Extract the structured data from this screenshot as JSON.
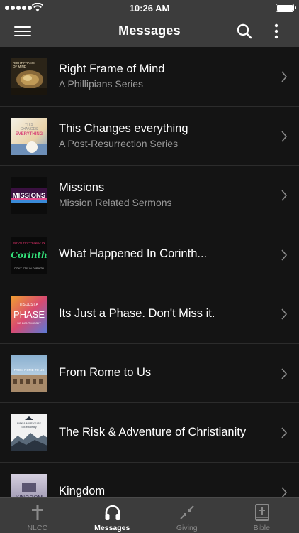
{
  "status_bar": {
    "time": "10:26 AM"
  },
  "nav": {
    "title": "Messages"
  },
  "series": [
    {
      "title": "Right Frame of Mind",
      "subtitle": "A Phillipians Series",
      "thumb_text": "RIGHT FRAME OF MIND"
    },
    {
      "title": "This Changes everything",
      "subtitle": "A Post-Resurrection Series",
      "thumb_text": "THIS CHANGES EVERYTHING"
    },
    {
      "title": "Missions",
      "subtitle": "Mission Related Sermons",
      "thumb_text": "MISSIONS"
    },
    {
      "title": "What Happened In Corinth...",
      "subtitle": "",
      "thumb_text": "WHAT HAPPENED IN Corinth"
    },
    {
      "title": "Its Just a Phase. Don't Miss it.",
      "subtitle": "",
      "thumb_text": "ITS JUST A PHASE SO DONT MISS IT"
    },
    {
      "title": "From Rome to Us",
      "subtitle": "",
      "thumb_text": "FROM ROME TO US"
    },
    {
      "title": "The Risk & Adventure of Christianity",
      "subtitle": "",
      "thumb_text": "RISK & ADVENTURE Christianity"
    },
    {
      "title": "Kingdom",
      "subtitle": "",
      "thumb_text": "KINGDOM"
    }
  ],
  "tabs": [
    {
      "label": "NLCC",
      "icon": "cross-icon"
    },
    {
      "label": "Messages",
      "icon": "headphones-icon"
    },
    {
      "label": "Giving",
      "icon": "compress-arrows-icon"
    },
    {
      "label": "Bible",
      "icon": "bible-book-icon"
    }
  ],
  "colors": {
    "bar": "#3c3c3c",
    "list_bg": "#141414",
    "subtitle": "#9a9a9a",
    "tab_inactive": "#8a8a8a"
  }
}
